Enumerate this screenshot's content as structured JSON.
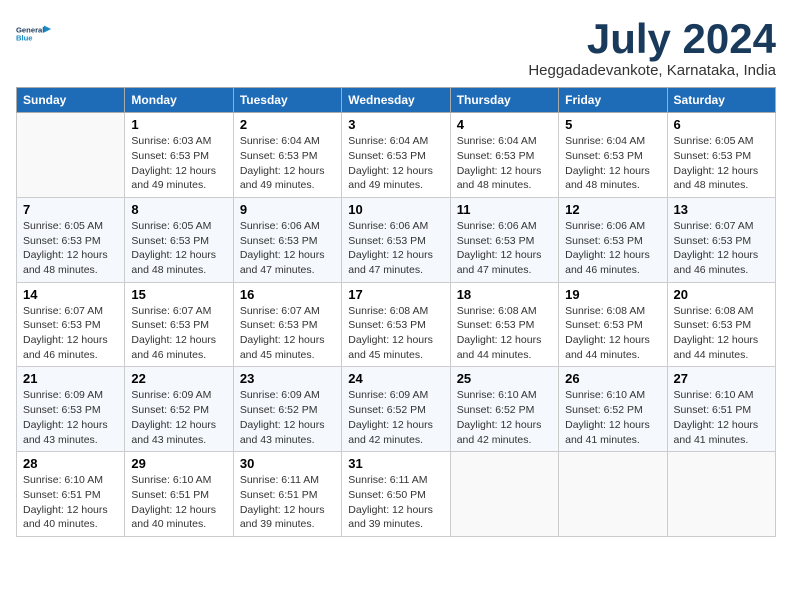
{
  "logo": {
    "line1": "General",
    "line2": "Blue"
  },
  "title": "July 2024",
  "location": "Heggadadevankote, Karnataka, India",
  "days_of_week": [
    "Sunday",
    "Monday",
    "Tuesday",
    "Wednesday",
    "Thursday",
    "Friday",
    "Saturday"
  ],
  "weeks": [
    [
      {
        "day": "",
        "info": ""
      },
      {
        "day": "1",
        "info": "Sunrise: 6:03 AM\nSunset: 6:53 PM\nDaylight: 12 hours\nand 49 minutes."
      },
      {
        "day": "2",
        "info": "Sunrise: 6:04 AM\nSunset: 6:53 PM\nDaylight: 12 hours\nand 49 minutes."
      },
      {
        "day": "3",
        "info": "Sunrise: 6:04 AM\nSunset: 6:53 PM\nDaylight: 12 hours\nand 49 minutes."
      },
      {
        "day": "4",
        "info": "Sunrise: 6:04 AM\nSunset: 6:53 PM\nDaylight: 12 hours\nand 48 minutes."
      },
      {
        "day": "5",
        "info": "Sunrise: 6:04 AM\nSunset: 6:53 PM\nDaylight: 12 hours\nand 48 minutes."
      },
      {
        "day": "6",
        "info": "Sunrise: 6:05 AM\nSunset: 6:53 PM\nDaylight: 12 hours\nand 48 minutes."
      }
    ],
    [
      {
        "day": "7",
        "info": "Sunrise: 6:05 AM\nSunset: 6:53 PM\nDaylight: 12 hours\nand 48 minutes."
      },
      {
        "day": "8",
        "info": "Sunrise: 6:05 AM\nSunset: 6:53 PM\nDaylight: 12 hours\nand 48 minutes."
      },
      {
        "day": "9",
        "info": "Sunrise: 6:06 AM\nSunset: 6:53 PM\nDaylight: 12 hours\nand 47 minutes."
      },
      {
        "day": "10",
        "info": "Sunrise: 6:06 AM\nSunset: 6:53 PM\nDaylight: 12 hours\nand 47 minutes."
      },
      {
        "day": "11",
        "info": "Sunrise: 6:06 AM\nSunset: 6:53 PM\nDaylight: 12 hours\nand 47 minutes."
      },
      {
        "day": "12",
        "info": "Sunrise: 6:06 AM\nSunset: 6:53 PM\nDaylight: 12 hours\nand 46 minutes."
      },
      {
        "day": "13",
        "info": "Sunrise: 6:07 AM\nSunset: 6:53 PM\nDaylight: 12 hours\nand 46 minutes."
      }
    ],
    [
      {
        "day": "14",
        "info": "Sunrise: 6:07 AM\nSunset: 6:53 PM\nDaylight: 12 hours\nand 46 minutes."
      },
      {
        "day": "15",
        "info": "Sunrise: 6:07 AM\nSunset: 6:53 PM\nDaylight: 12 hours\nand 46 minutes."
      },
      {
        "day": "16",
        "info": "Sunrise: 6:07 AM\nSunset: 6:53 PM\nDaylight: 12 hours\nand 45 minutes."
      },
      {
        "day": "17",
        "info": "Sunrise: 6:08 AM\nSunset: 6:53 PM\nDaylight: 12 hours\nand 45 minutes."
      },
      {
        "day": "18",
        "info": "Sunrise: 6:08 AM\nSunset: 6:53 PM\nDaylight: 12 hours\nand 44 minutes."
      },
      {
        "day": "19",
        "info": "Sunrise: 6:08 AM\nSunset: 6:53 PM\nDaylight: 12 hours\nand 44 minutes."
      },
      {
        "day": "20",
        "info": "Sunrise: 6:08 AM\nSunset: 6:53 PM\nDaylight: 12 hours\nand 44 minutes."
      }
    ],
    [
      {
        "day": "21",
        "info": "Sunrise: 6:09 AM\nSunset: 6:53 PM\nDaylight: 12 hours\nand 43 minutes."
      },
      {
        "day": "22",
        "info": "Sunrise: 6:09 AM\nSunset: 6:52 PM\nDaylight: 12 hours\nand 43 minutes."
      },
      {
        "day": "23",
        "info": "Sunrise: 6:09 AM\nSunset: 6:52 PM\nDaylight: 12 hours\nand 43 minutes."
      },
      {
        "day": "24",
        "info": "Sunrise: 6:09 AM\nSunset: 6:52 PM\nDaylight: 12 hours\nand 42 minutes."
      },
      {
        "day": "25",
        "info": "Sunrise: 6:10 AM\nSunset: 6:52 PM\nDaylight: 12 hours\nand 42 minutes."
      },
      {
        "day": "26",
        "info": "Sunrise: 6:10 AM\nSunset: 6:52 PM\nDaylight: 12 hours\nand 41 minutes."
      },
      {
        "day": "27",
        "info": "Sunrise: 6:10 AM\nSunset: 6:51 PM\nDaylight: 12 hours\nand 41 minutes."
      }
    ],
    [
      {
        "day": "28",
        "info": "Sunrise: 6:10 AM\nSunset: 6:51 PM\nDaylight: 12 hours\nand 40 minutes."
      },
      {
        "day": "29",
        "info": "Sunrise: 6:10 AM\nSunset: 6:51 PM\nDaylight: 12 hours\nand 40 minutes."
      },
      {
        "day": "30",
        "info": "Sunrise: 6:11 AM\nSunset: 6:51 PM\nDaylight: 12 hours\nand 39 minutes."
      },
      {
        "day": "31",
        "info": "Sunrise: 6:11 AM\nSunset: 6:50 PM\nDaylight: 12 hours\nand 39 minutes."
      },
      {
        "day": "",
        "info": ""
      },
      {
        "day": "",
        "info": ""
      },
      {
        "day": "",
        "info": ""
      }
    ]
  ]
}
